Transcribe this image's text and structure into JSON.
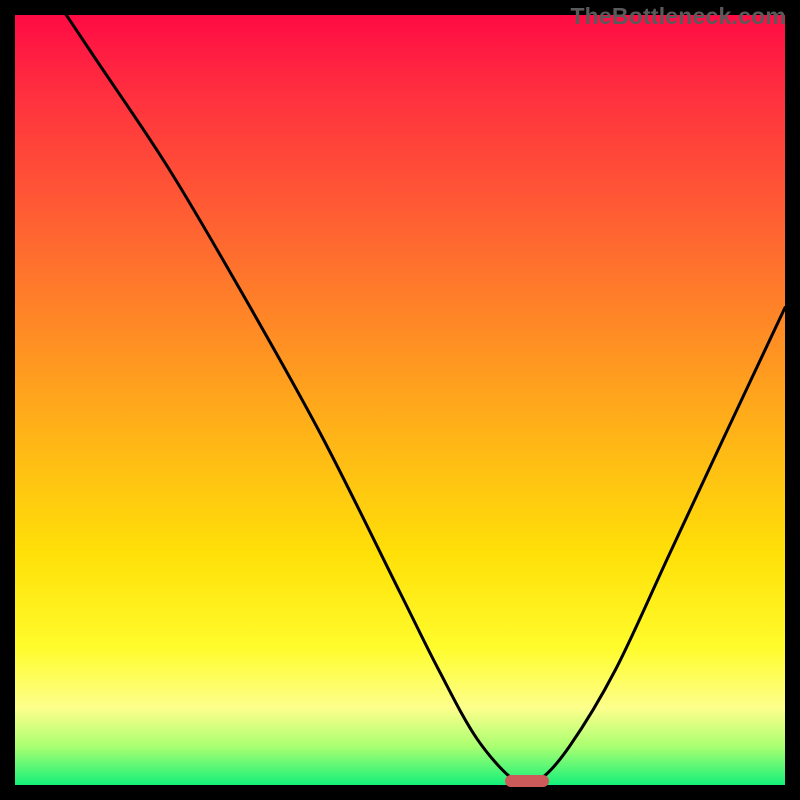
{
  "watermark": "TheBottleneck.com",
  "chart_data": {
    "type": "line",
    "title": "",
    "xlabel": "",
    "ylabel": "",
    "xlim": [
      0,
      100
    ],
    "ylim": [
      0,
      100
    ],
    "series": [
      {
        "name": "bottleneck-curve",
        "x": [
          0,
          10,
          20,
          30,
          40,
          50,
          55,
          60,
          65,
          68,
          72,
          78,
          85,
          92,
          100
        ],
        "values": [
          110,
          95,
          80,
          63,
          45,
          25,
          15,
          6,
          0.5,
          0.6,
          5,
          15,
          30,
          45,
          62
        ]
      }
    ],
    "annotations": [
      {
        "name": "min-marker",
        "x": 66.5,
        "y": 0.5,
        "shape": "pill",
        "color": "#cc5a5a"
      }
    ],
    "background_gradient": {
      "stops": [
        {
          "pos": 0,
          "color": "#ff0b44"
        },
        {
          "pos": 25,
          "color": "#ff5b34"
        },
        {
          "pos": 55,
          "color": "#ffb517"
        },
        {
          "pos": 82,
          "color": "#fffc2b"
        },
        {
          "pos": 100,
          "color": "#13f07a"
        }
      ]
    }
  },
  "colors": {
    "curve": "#000000",
    "marker": "#cc5a5a",
    "frame": "#000000",
    "watermark": "#5a5a5a"
  }
}
